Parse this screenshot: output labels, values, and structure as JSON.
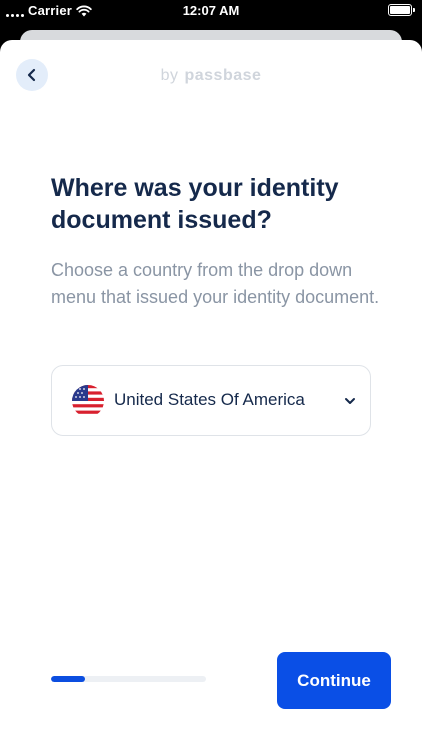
{
  "status_bar": {
    "carrier": "Carrier",
    "time": "12:07 AM",
    "icons": [
      "signal-icon",
      "wifi-icon",
      "battery-icon"
    ]
  },
  "header": {
    "back_icon": "chevron-left-icon",
    "brand_prefix": "by",
    "brand_name": "passbase"
  },
  "main": {
    "title": "Where was your identity document issued?",
    "subtitle": "Choose a country from the drop down menu that issued your identity document.",
    "country_select": {
      "selected": "United States Of America",
      "flag_icon": "us-flag-icon",
      "chevron_icon": "chevron-down-icon"
    }
  },
  "footer": {
    "progress_fraction": 0.22,
    "continue_label": "Continue"
  },
  "colors": {
    "primary": "#0a4fe6",
    "title": "#15294b",
    "subtitle": "#8a95a4",
    "brand": "#d0d5dc",
    "back_button_bg": "#e3edfa",
    "progress_track": "#edf0f4"
  }
}
